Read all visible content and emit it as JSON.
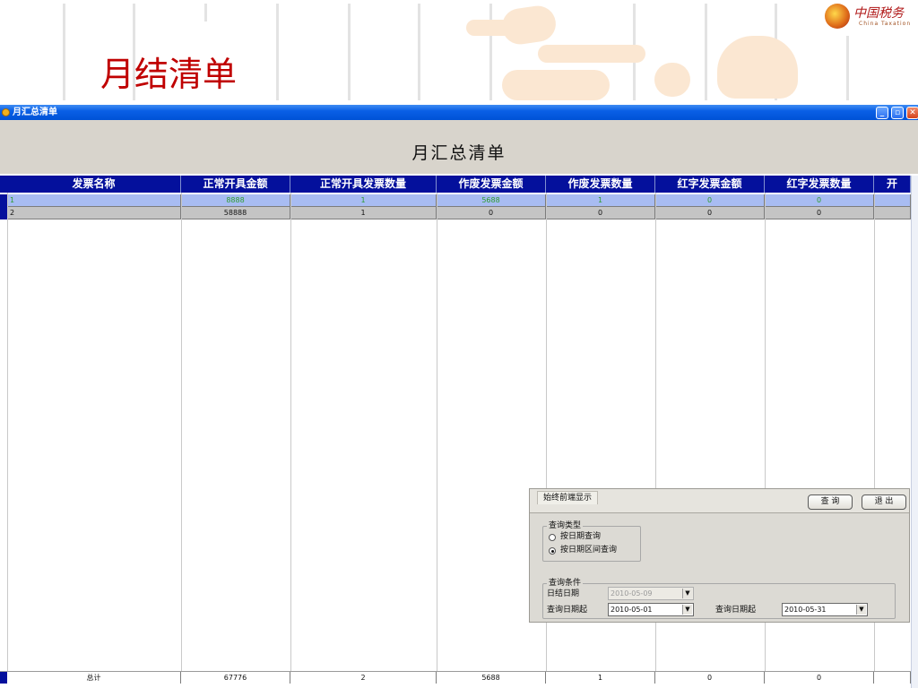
{
  "slide": {
    "title": "月结清单",
    "logo_text": "中国税务",
    "logo_subtext": "China Taxation"
  },
  "window": {
    "title": "月汇总清单",
    "minimize": "_",
    "restore": "▫",
    "close": "✕"
  },
  "banner": {
    "title": "月汇总清单"
  },
  "grid": {
    "columns": [
      "发票名称",
      "正常开具金额",
      "正常开具发票数量",
      "作废发票金额",
      "作废发票数量",
      "红字发票金额",
      "红字发票数量",
      "开"
    ],
    "rows": [
      {
        "cells": [
          "1",
          "8888",
          "1",
          "5688",
          "1",
          "0",
          "0",
          ""
        ]
      },
      {
        "cells": [
          "2",
          "58888",
          "1",
          "0",
          "0",
          "0",
          "0",
          ""
        ]
      }
    ],
    "total": [
      "总计",
      "67776",
      "2",
      "5688",
      "1",
      "0",
      "0",
      ""
    ]
  },
  "colors": {
    "header_bg": "#04109c",
    "row1_bg": "#a8bcf2",
    "row1_text": "#2e9c2e",
    "row2_bg": "#c4c4c4",
    "title_red": "#c00000"
  },
  "query_panel": {
    "tab_label": "始终前端显示",
    "query_button": "查 询",
    "exit_button": "退 出",
    "type_group_label": "查询类型",
    "option_by_date": "按日期查询",
    "option_by_range": "按日期区间查询",
    "selected_option": "按日期区间查询",
    "condition_group_label": "查询条件",
    "settle_date_label": "日结日期",
    "settle_date_value": "2010-05-09",
    "start_date_label": "查询日期起",
    "start_date_value": "2010-05-01",
    "end_date_label": "查询日期起",
    "end_date_value": "2010-05-31",
    "dropdown_icon": "▼"
  }
}
